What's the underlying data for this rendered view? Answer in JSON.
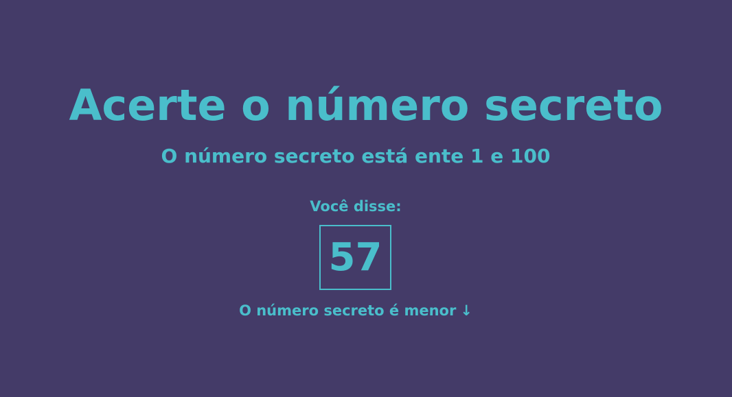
{
  "title": "Acerte o número secreto",
  "subtitle": "O número secreto está ente 1 e 100",
  "guess": {
    "label": "Você disse:",
    "value": "57"
  },
  "hint": {
    "text": "O número secreto é menor",
    "arrow": "↓"
  },
  "colors": {
    "background": "#443B68",
    "accent": "#4ABECB"
  },
  "icons": {
    "hint_arrow": "arrow-down-icon"
  }
}
